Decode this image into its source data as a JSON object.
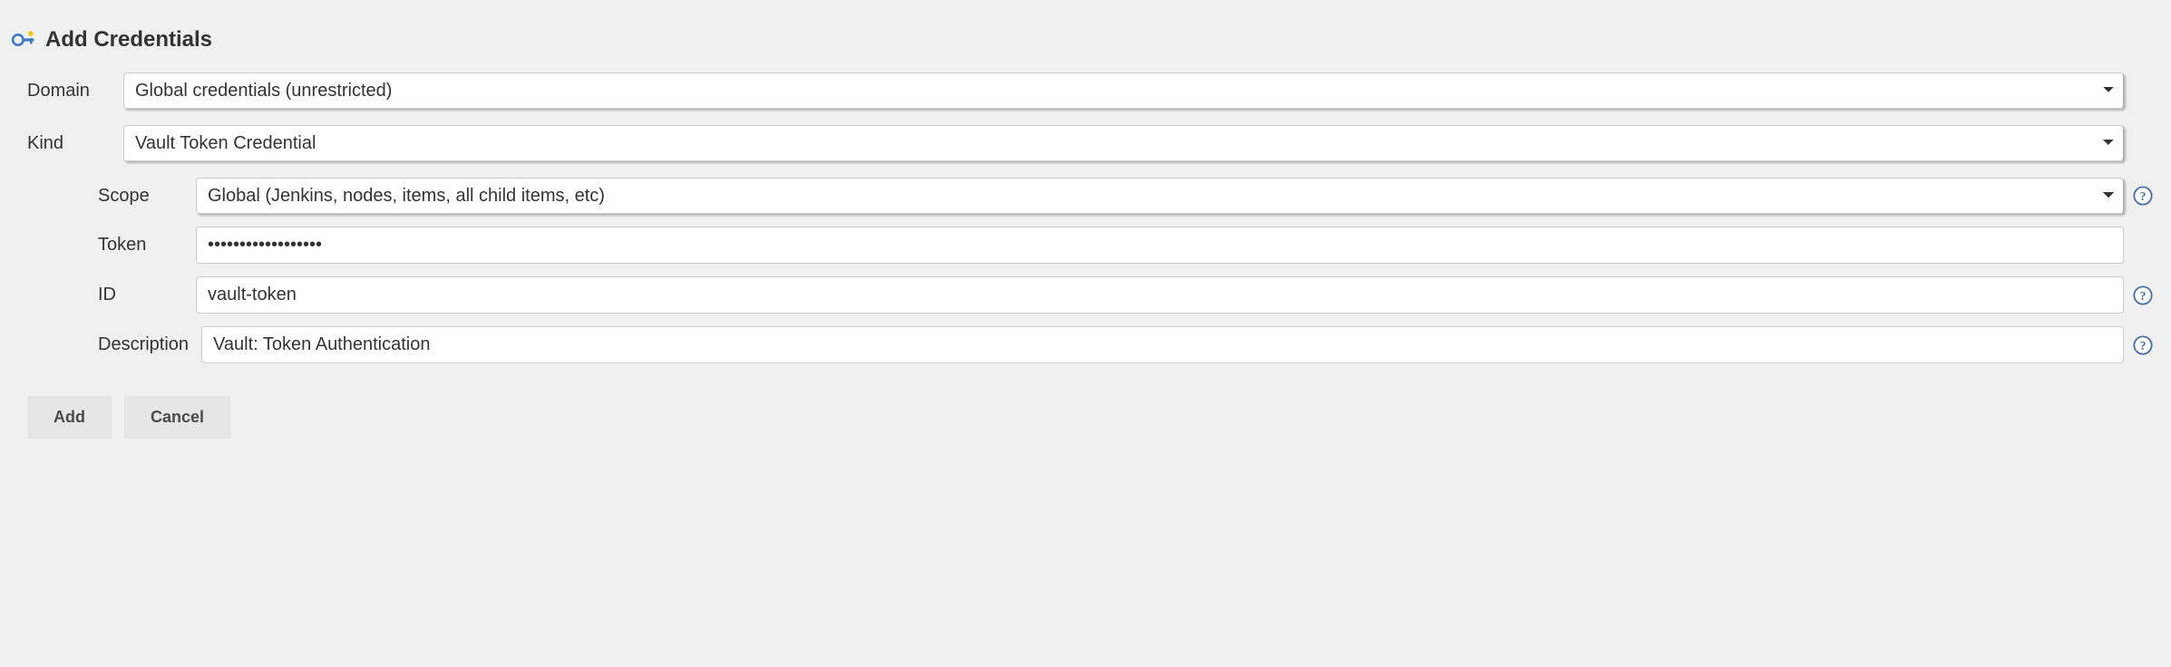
{
  "title": "Add Credentials",
  "fields": {
    "domain": {
      "label": "Domain",
      "value": "Global credentials (unrestricted)"
    },
    "kind": {
      "label": "Kind",
      "value": "Vault Token Credential"
    },
    "scope": {
      "label": "Scope",
      "value": "Global (Jenkins, nodes, items, all child items, etc)"
    },
    "token": {
      "label": "Token",
      "value": "••••••••••••••••••"
    },
    "id": {
      "label": "ID",
      "value": "vault-token"
    },
    "description": {
      "label": "Description",
      "value": "Vault: Token Authentication"
    }
  },
  "buttons": {
    "add": "Add",
    "cancel": "Cancel"
  }
}
